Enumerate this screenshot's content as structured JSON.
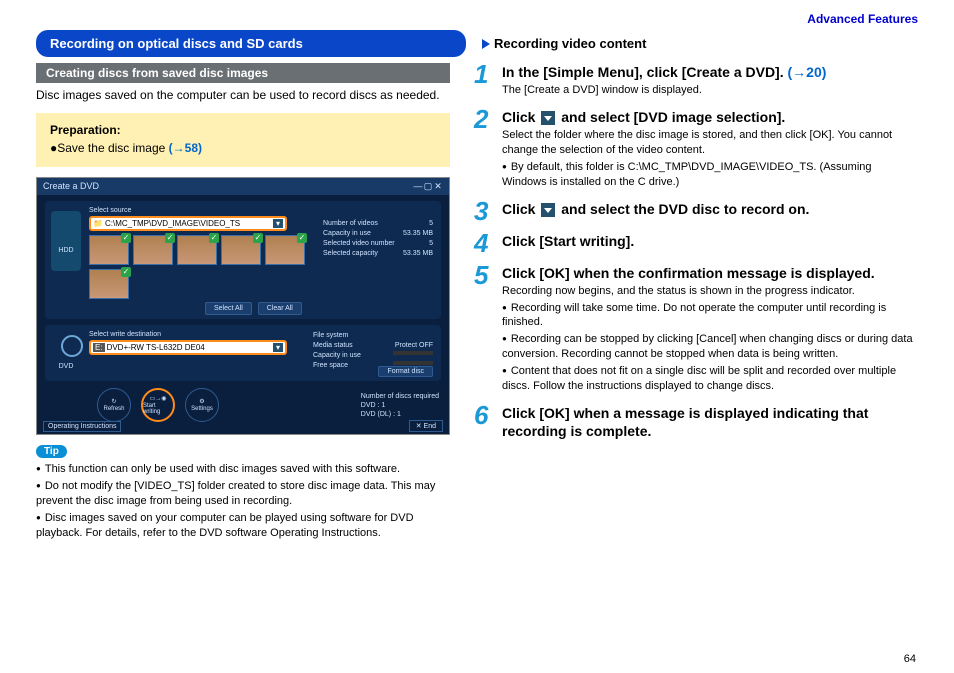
{
  "header_link": "Advanced Features",
  "topbar": {
    "left": "Recording on optical discs and SD cards",
    "right": "Recording video content"
  },
  "left": {
    "sub_heading": "Creating discs from saved disc images",
    "intro": "Disc images saved on the computer can be used to record discs as needed.",
    "prep": {
      "title": "Preparation:",
      "item": "Save the disc image",
      "link": "(→58)"
    },
    "screenshot": {
      "title": "Create a DVD",
      "hdd": "HDD",
      "path": "C:\\MC_TMP\\DVD_IMAGE\\VIDEO_TS",
      "info": {
        "num_videos_l": "Number of videos",
        "num_videos_v": "5",
        "cap_l": "Capacity in use",
        "cap_v": "53.35 MB",
        "sel_num_l": "Selected video number",
        "sel_num_v": "5",
        "sel_cap_l": "Selected capacity",
        "sel_cap_v": "53.35 MB"
      },
      "select_all": "Select All",
      "clear_all": "Clear All",
      "dvd": "DVD",
      "drive_letter": "E:",
      "drive": "DVD+-RW TS-L632D DE04",
      "info2": {
        "fs_l": "File system",
        "fs_v": "",
        "media_l": "Media status",
        "protect_l": "Protect OFF",
        "cap_l": "Capacity in use",
        "free_l": "Free space"
      },
      "format": "Format disc",
      "btn_refresh": "Refresh",
      "btn_start": "Start writing",
      "btn_settings": "Settings",
      "req1": "Number of discs required",
      "req2": "DVD : 1",
      "req3": "DVD (DL) : 1",
      "op": "Operating Instructions",
      "end": "✕  End"
    },
    "tip_label": "Tip",
    "tips": [
      "This function can only be used with disc images saved with this software.",
      "Do not modify the [VIDEO_TS] folder created to store disc image data. This may prevent the disc image from being used in recording.",
      "Disc images saved on your computer can be played using software for DVD playback. For details, refer to the DVD software Operating Instructions."
    ]
  },
  "steps": {
    "s1": {
      "n": "1",
      "title_a": "In the [Simple Menu], click [Create a DVD]. ",
      "link": "(→20)",
      "sub": "The [Create a DVD] window is displayed."
    },
    "s2": {
      "n": "2",
      "title_a": "Click ",
      "title_b": " and select [DVD image selection].",
      "sub": "Select the folder where the disc image is stored, and then click [OK]. You cannot change the selection of the video content.",
      "bullets": [
        "By default, this folder is C:\\MC_TMP\\DVD_IMAGE\\VIDEO_TS. (Assuming Windows is installed on the C drive.)"
      ]
    },
    "s3": {
      "n": "3",
      "title_a": "Click ",
      "title_b": " and select the DVD disc to record on."
    },
    "s4": {
      "n": "4",
      "title": "Click [Start writing]."
    },
    "s5": {
      "n": "5",
      "title": "Click [OK] when the confirmation message is displayed.",
      "sub": "Recording now begins, and the status is shown in the progress indicator.",
      "bullets": [
        "Recording will take some time. Do not operate the computer until recording is finished.",
        "Recording can be stopped by clicking [Cancel] when changing discs or during data conversion. Recording cannot be stopped when data is being written.",
        "Content that does not fit on a single disc will be split and recorded over multiple discs. Follow the instructions displayed to change discs."
      ]
    },
    "s6": {
      "n": "6",
      "title": "Click [OK] when a message is displayed indicating that recording is complete."
    }
  },
  "page_num": "64"
}
